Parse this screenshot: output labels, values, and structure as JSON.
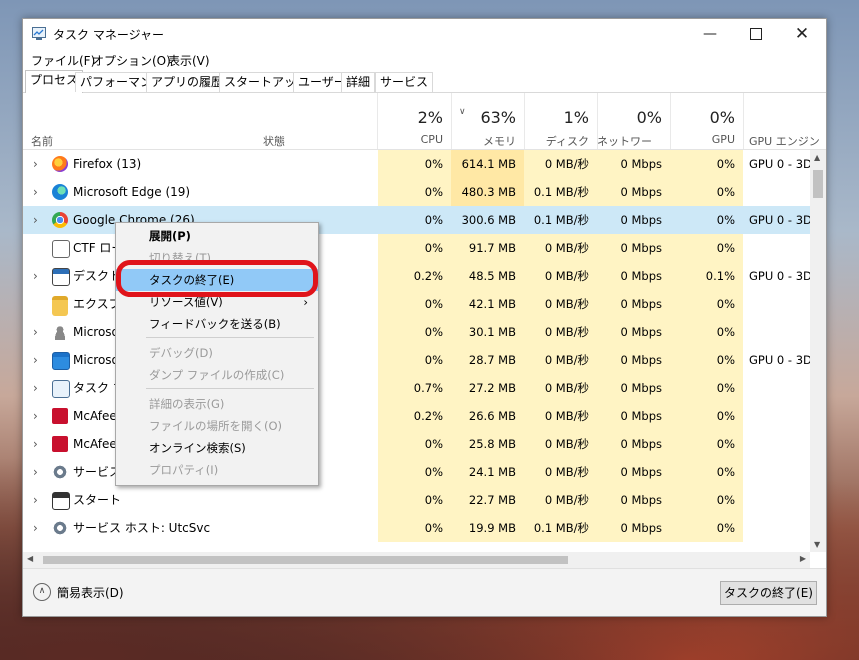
{
  "window": {
    "title": "タスク マネージャー"
  },
  "menu": [
    "ファイル(F)",
    "オプション(O)",
    "表示(V)"
  ],
  "tabs": [
    "プロセス",
    "パフォーマンス",
    "アプリの履歴",
    "スタートアップ",
    "ユーザー",
    "詳細",
    "サービス"
  ],
  "header": {
    "name": "名前",
    "status": "状態",
    "cpu_pct": "2%",
    "cpu": "CPU",
    "mem_pct": "63%",
    "mem": "メモリ",
    "disk_pct": "1%",
    "disk": "ディスク",
    "net_pct": "0%",
    "net": "ネットワーク",
    "gpu_pct": "0%",
    "gpu": "GPU",
    "gpu_engine": "GPU エンジン"
  },
  "rows": [
    {
      "name": "Firefox (13)",
      "cpu": "0%",
      "mem": "614.1 MB",
      "disk": "0 MB/秒",
      "net": "0 Mbps",
      "gpu": "0%",
      "engine": "GPU 0 - 3D",
      "icon": "firefox-icon"
    },
    {
      "name": "Microsoft Edge (19)",
      "cpu": "0%",
      "mem": "480.3 MB",
      "disk": "0.1 MB/秒",
      "net": "0 Mbps",
      "gpu": "0%",
      "engine": "",
      "icon": "edge-icon"
    },
    {
      "name": "Google Chrome (26)",
      "cpu": "0%",
      "mem": "300.6 MB",
      "disk": "0.1 MB/秒",
      "net": "0 Mbps",
      "gpu": "0%",
      "engine": "GPU 0 - 3D",
      "icon": "chrome-icon"
    },
    {
      "name": "CTF ロー",
      "cpu": "0%",
      "mem": "91.7 MB",
      "disk": "0 MB/秒",
      "net": "0 Mbps",
      "gpu": "0%",
      "engine": "",
      "icon": "ctf-icon"
    },
    {
      "name": "デスクトッ",
      "cpu": "0.2%",
      "mem": "48.5 MB",
      "disk": "0 MB/秒",
      "net": "0 Mbps",
      "gpu": "0.1%",
      "engine": "GPU 0 - 3D",
      "icon": "desktop-window-icon"
    },
    {
      "name": "エクスプロ",
      "cpu": "0%",
      "mem": "42.1 MB",
      "disk": "0 MB/秒",
      "net": "0 Mbps",
      "gpu": "0%",
      "engine": "",
      "icon": "folder-icon"
    },
    {
      "name": "Microso",
      "cpu": "0%",
      "mem": "30.1 MB",
      "disk": "0 MB/秒",
      "net": "0 Mbps",
      "gpu": "0%",
      "engine": "",
      "icon": "user-icon"
    },
    {
      "name": "Microso",
      "cpu": "0%",
      "mem": "28.7 MB",
      "disk": "0 MB/秒",
      "net": "0 Mbps",
      "gpu": "0%",
      "engine": "GPU 0 - 3D",
      "icon": "window-icon"
    },
    {
      "name": "タスク マ",
      "cpu": "0.7%",
      "mem": "27.2 MB",
      "disk": "0 MB/秒",
      "net": "0 Mbps",
      "gpu": "0%",
      "engine": "",
      "icon": "task-manager-icon"
    },
    {
      "name": "McAfee",
      "cpu": "0.2%",
      "mem": "26.6 MB",
      "disk": "0 MB/秒",
      "net": "0 Mbps",
      "gpu": "0%",
      "engine": "",
      "icon": "mcafee-icon"
    },
    {
      "name": "McAfee",
      "cpu": "0%",
      "mem": "25.8 MB",
      "disk": "0 MB/秒",
      "net": "0 Mbps",
      "gpu": "0%",
      "engine": "",
      "icon": "mcafee-icon"
    },
    {
      "name": "サービス",
      "cpu": "0%",
      "mem": "24.1 MB",
      "disk": "0 MB/秒",
      "net": "0 Mbps",
      "gpu": "0%",
      "engine": "",
      "icon": "gear-icon"
    },
    {
      "name": "スタート",
      "cpu": "0%",
      "mem": "22.7 MB",
      "disk": "0 MB/秒",
      "net": "0 Mbps",
      "gpu": "0%",
      "engine": "",
      "icon": "start-icon"
    },
    {
      "name": "サービス ホスト: UtcSvc",
      "cpu": "0%",
      "mem": "19.9 MB",
      "disk": "0.1 MB/秒",
      "net": "0 Mbps",
      "gpu": "0%",
      "engine": "",
      "icon": "gear-icon"
    }
  ],
  "context_menu": [
    {
      "label": "展開(P)",
      "state": "bold"
    },
    {
      "label": "切り替え(T)",
      "state": "disabled"
    },
    {
      "label": "タスクの終了(E)",
      "state": "highlight"
    },
    {
      "label": "リソース値(V)",
      "state": "normal"
    },
    {
      "label": "フィードバックを送る(B)",
      "state": "normal"
    },
    {
      "label": "デバッグ(D)",
      "state": "disabled"
    },
    {
      "label": "ダンプ ファイルの作成(C)",
      "state": "disabled"
    },
    {
      "label": "詳細の表示(G)",
      "state": "disabled"
    },
    {
      "label": "ファイルの場所を開く(O)",
      "state": "disabled"
    },
    {
      "label": "オンライン検索(S)",
      "state": "normal"
    },
    {
      "label": "プロパティ(I)",
      "state": "disabled"
    }
  ],
  "footer": {
    "fewer_details": "簡易表示(D)",
    "end_task": "タスクの終了(E)"
  },
  "colors": {
    "heat_light": "#fff4c4",
    "heat_mid": "#ffe8a5",
    "selected": "#cde8f7",
    "highlight": "#91c9f7",
    "ring": "#e0141b"
  }
}
